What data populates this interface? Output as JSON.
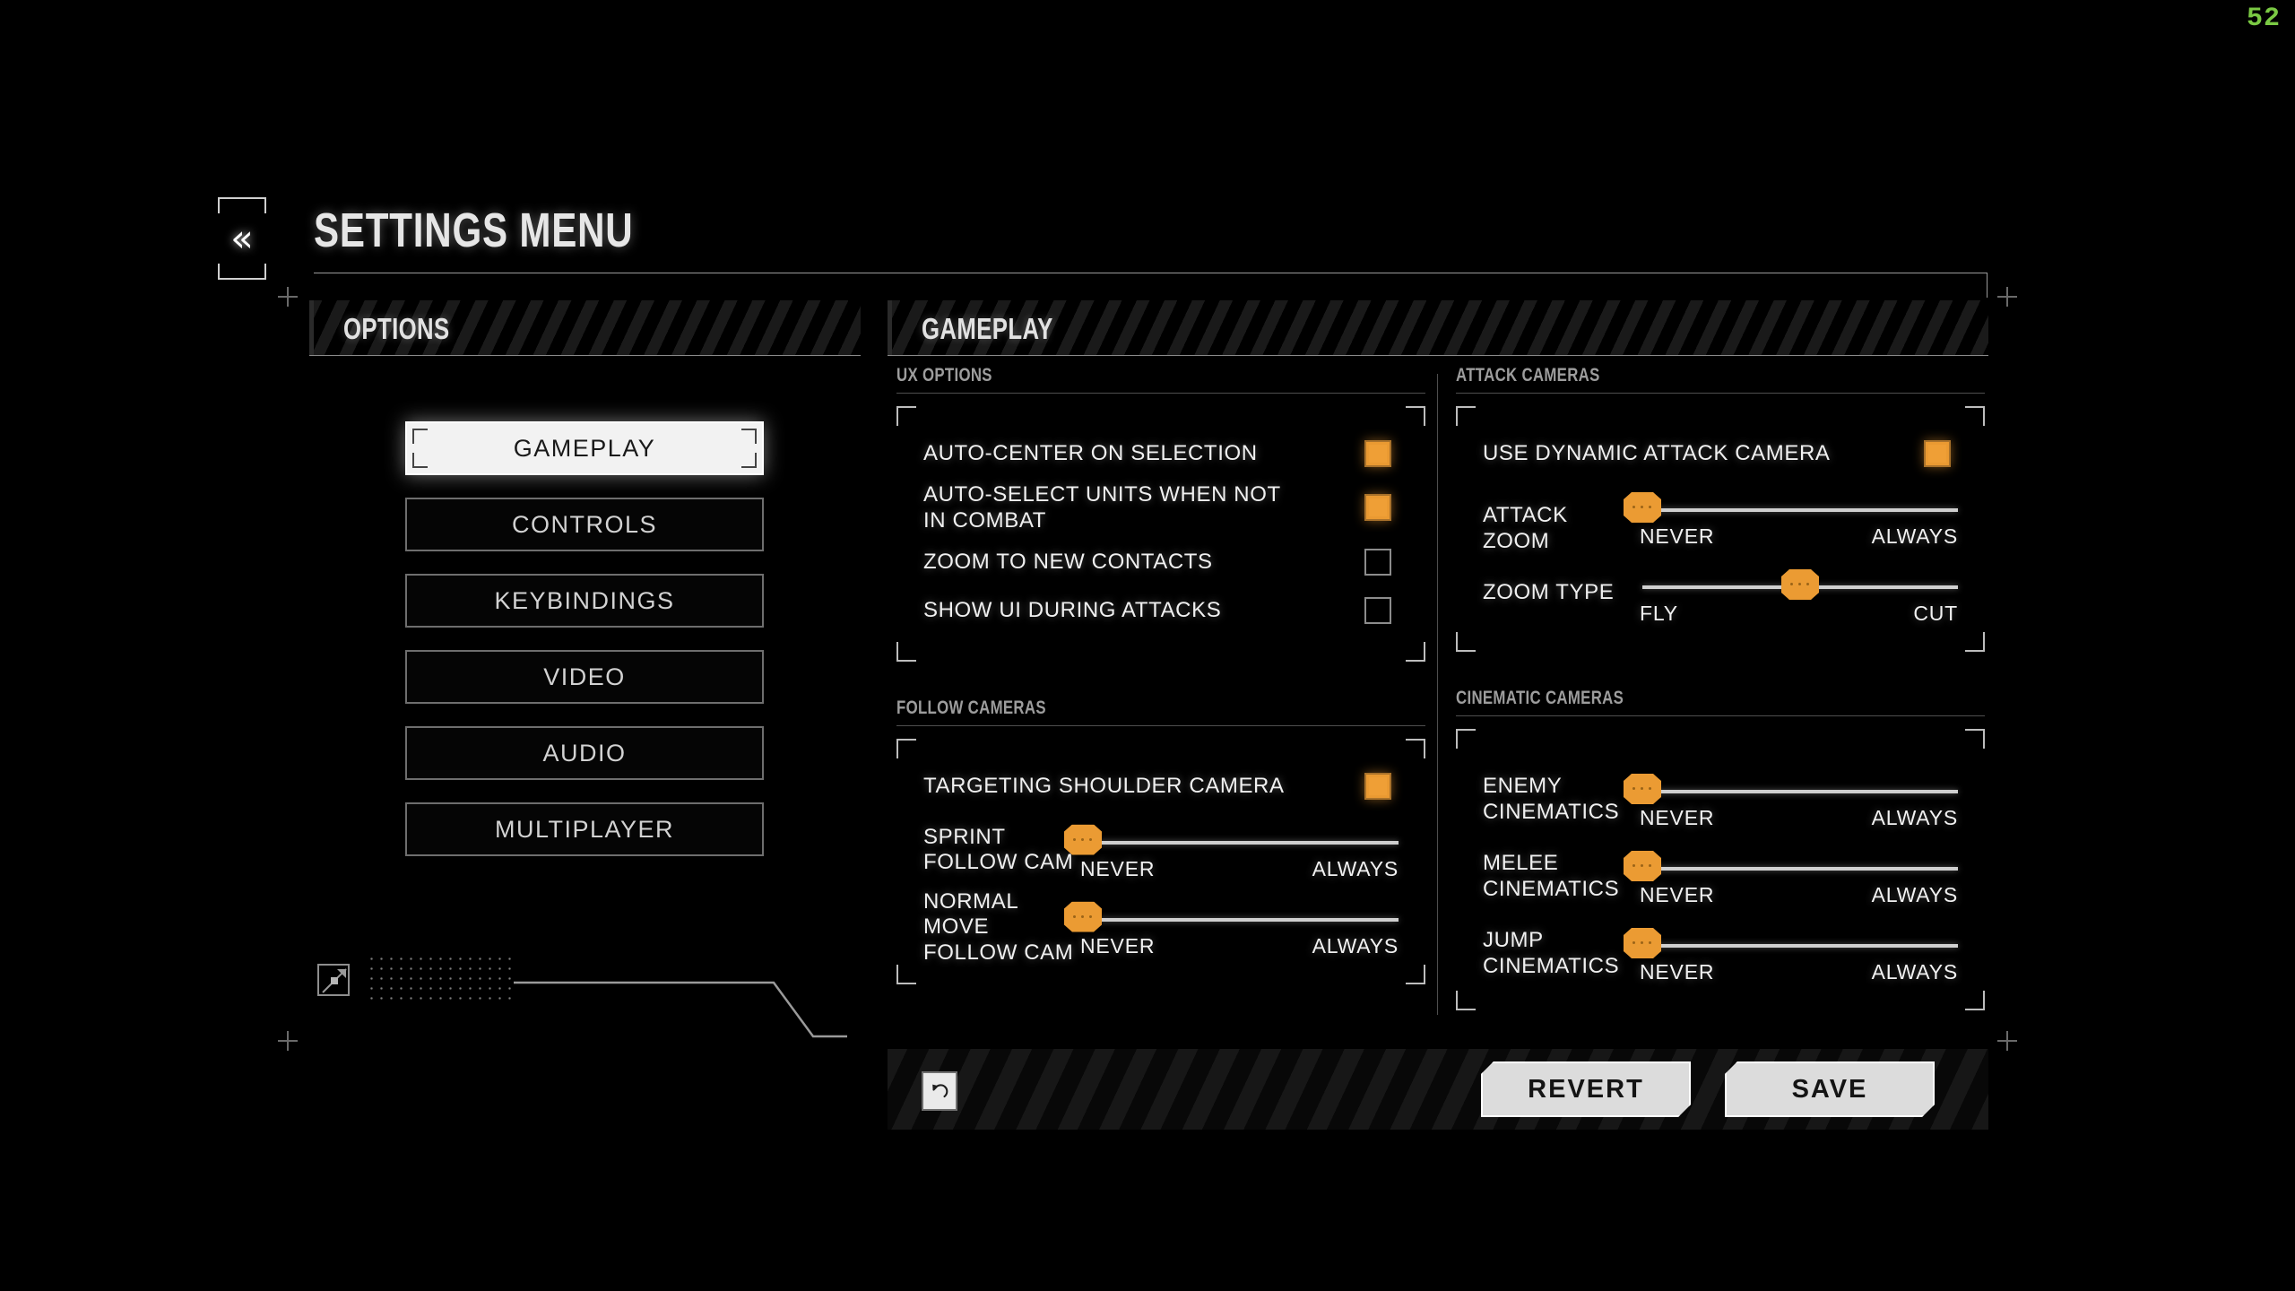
{
  "hud": {
    "fps": "52"
  },
  "header": {
    "title": "SETTINGS MENU",
    "back_icon": "double-chevron-left-icon"
  },
  "options_panel": {
    "header": "OPTIONS",
    "items": [
      {
        "label": "GAMEPLAY",
        "active": true
      },
      {
        "label": "CONTROLS",
        "active": false
      },
      {
        "label": "KEYBINDINGS",
        "active": false
      },
      {
        "label": "VIDEO",
        "active": false
      },
      {
        "label": "AUDIO",
        "active": false
      },
      {
        "label": "MULTIPLAYER",
        "active": false
      }
    ]
  },
  "content_panel": {
    "header": "GAMEPLAY",
    "sections": {
      "ux_options": {
        "title": "UX OPTIONS",
        "checkboxes": [
          {
            "label": "AUTO-CENTER ON SELECTION",
            "checked": true
          },
          {
            "label": "AUTO-SELECT UNITS WHEN NOT IN COMBAT",
            "checked": true
          },
          {
            "label": "ZOOM TO NEW CONTACTS",
            "checked": false
          },
          {
            "label": "SHOW UI DURING ATTACKS",
            "checked": false
          }
        ]
      },
      "follow_cameras": {
        "title": "FOLLOW CAMERAS",
        "checkboxes": [
          {
            "label": "TARGETING SHOULDER CAMERA",
            "checked": true
          }
        ],
        "sliders": [
          {
            "label": "SPRINT FOLLOW CAM",
            "min_label": "NEVER",
            "max_label": "ALWAYS",
            "value": 0
          },
          {
            "label": "NORMAL MOVE FOLLOW CAM",
            "min_label": "NEVER",
            "max_label": "ALWAYS",
            "value": 0
          }
        ]
      },
      "attack_cameras": {
        "title": "ATTACK CAMERAS",
        "checkboxes": [
          {
            "label": "USE DYNAMIC ATTACK CAMERA",
            "checked": true
          }
        ],
        "sliders": [
          {
            "label": "ATTACK ZOOM",
            "min_label": "NEVER",
            "max_label": "ALWAYS",
            "value": 0
          },
          {
            "label": "ZOOM TYPE",
            "min_label": "FLY",
            "max_label": "CUT",
            "value": 50
          }
        ]
      },
      "cinematic_cameras": {
        "title": "CINEMATIC CAMERAS",
        "checkboxes": [],
        "sliders": [
          {
            "label": "ENEMY CINEMATICS",
            "min_label": "NEVER",
            "max_label": "ALWAYS",
            "value": 0
          },
          {
            "label": "MELEE CINEMATICS",
            "min_label": "NEVER",
            "max_label": "ALWAYS",
            "value": 0
          },
          {
            "label": "JUMP CINEMATICS",
            "min_label": "NEVER",
            "max_label": "ALWAYS",
            "value": 0
          }
        ]
      }
    }
  },
  "footer": {
    "reset_icon": "undo-arrow-icon",
    "revert_label": "REVERT",
    "save_label": "SAVE"
  },
  "colors": {
    "accent_orange": "#eb9b33",
    "fps_green": "#7ac943",
    "panel_bg": "#000000",
    "text": "#f0f0f0"
  }
}
